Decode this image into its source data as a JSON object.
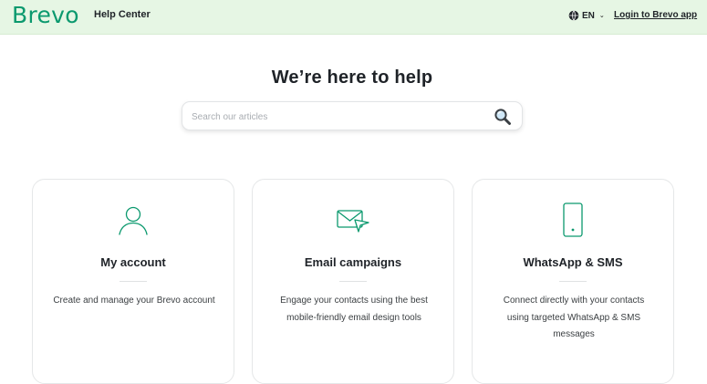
{
  "header": {
    "brand": "Brevo",
    "section_title": "Help Center",
    "language": "EN",
    "login_link": "Login to Brevo app"
  },
  "hero": {
    "title": "We’re here to help"
  },
  "search": {
    "placeholder": "Search our articles",
    "value": ""
  },
  "cards": [
    {
      "icon": "user-icon",
      "title": "My account",
      "description": "Create and manage your Brevo account"
    },
    {
      "icon": "envelope-send-icon",
      "title": "Email campaigns",
      "description": "Engage your contacts using the best mobile-friendly email design tools"
    },
    {
      "icon": "smartphone-icon",
      "title": "WhatsApp & SMS",
      "description": "Connect directly with your contacts using targeted WhatsApp & SMS messages"
    }
  ],
  "colors": {
    "brand_green": "#0b996e",
    "header_bg": "#e6f6e4",
    "icon_stroke": "#0b996e"
  }
}
